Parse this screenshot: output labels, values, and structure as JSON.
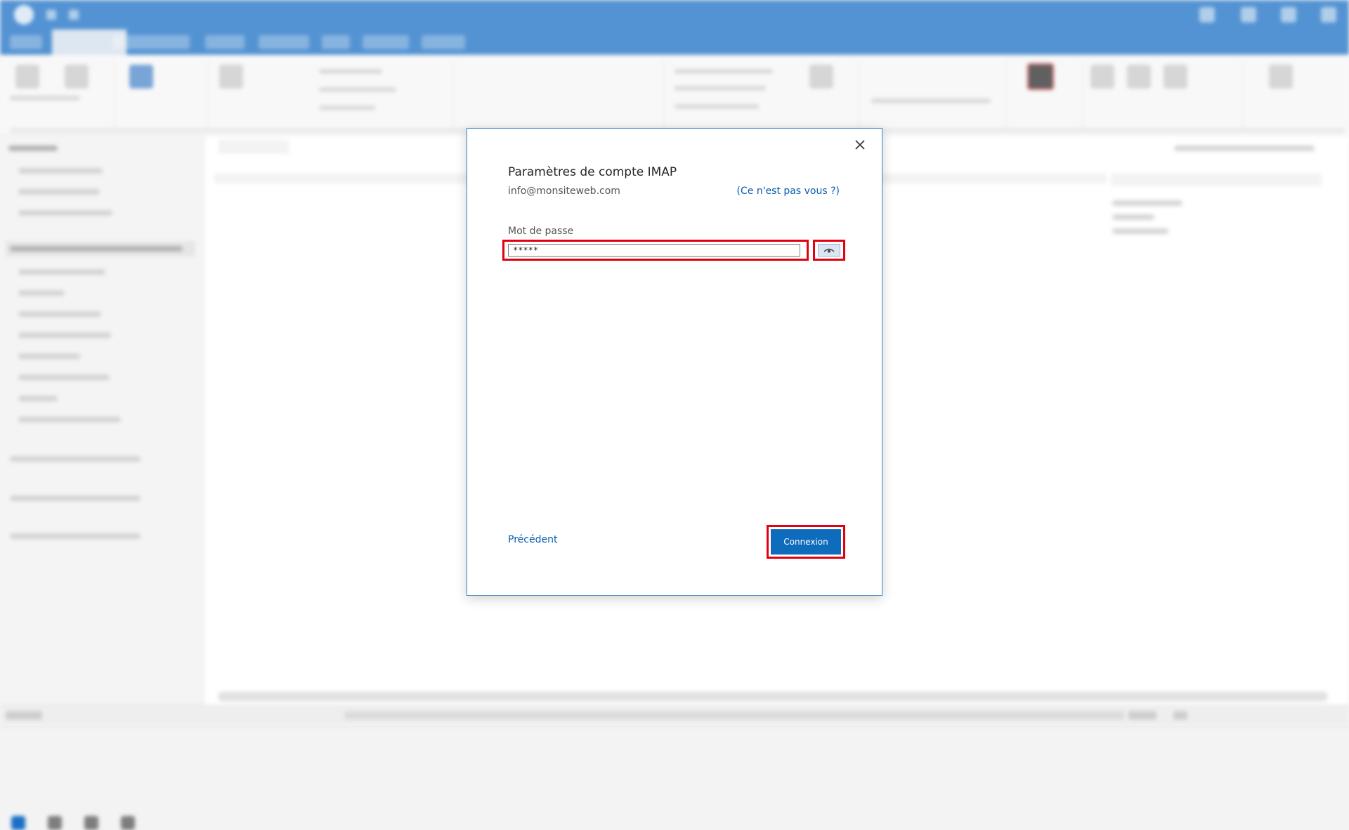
{
  "dialog": {
    "title": "Paramètres de compte IMAP",
    "email": "info@monsiteweb.com",
    "not_you_link": "(Ce n'est pas vous ?)",
    "password_label": "Mot de passe",
    "password_value": "*****",
    "back_link": "Précédent",
    "connect_button": "Connexion"
  },
  "icons": {
    "close": "close-icon",
    "reveal": "eye-icon"
  },
  "colors": {
    "accent": "#0f6cbd",
    "titlebar": "#1a6fc4",
    "highlight": "#e3000f",
    "link": "#0b5cad"
  }
}
